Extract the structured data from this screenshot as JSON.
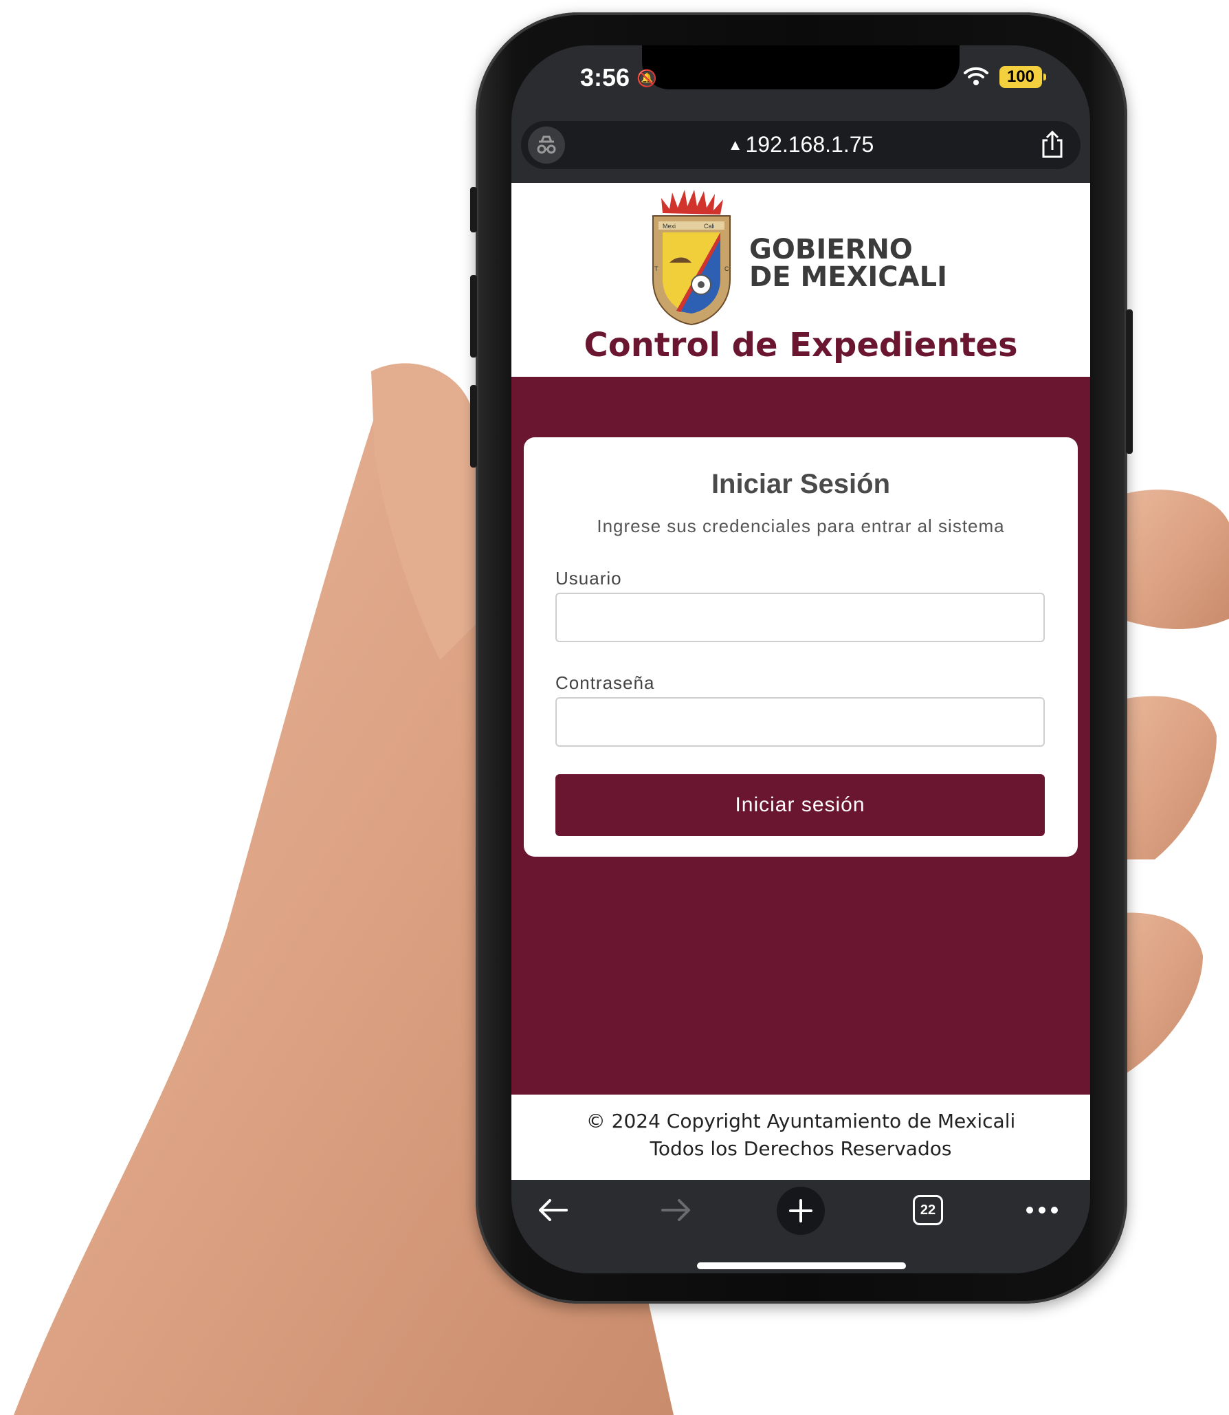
{
  "status_bar": {
    "time": "3:56",
    "battery": "100"
  },
  "browser": {
    "url": "192.168.1.75",
    "tab_count": "22"
  },
  "header": {
    "org_line1": "GOBIERNO",
    "org_line2": "DE MEXICALI",
    "crest_text": [
      "Mexi",
      "Cali",
      "TIERRA",
      "CALIDA"
    ],
    "app_title": "Control de Expedientes"
  },
  "login": {
    "title": "Iniciar Sesión",
    "subtitle": "Ingrese sus credenciales para entrar al sistema",
    "username_label": "Usuario",
    "username_value": "",
    "password_label": "Contraseña",
    "password_value": "",
    "submit_label": "Iniciar sesión"
  },
  "footer": {
    "line1": "© 2024 Copyright Ayuntamiento de Mexicali",
    "line2": "Todos los Derechos Reservados"
  },
  "colors": {
    "brand": "#6b1631",
    "browser_chrome": "#2a2c30",
    "battery": "#f4d03f"
  }
}
